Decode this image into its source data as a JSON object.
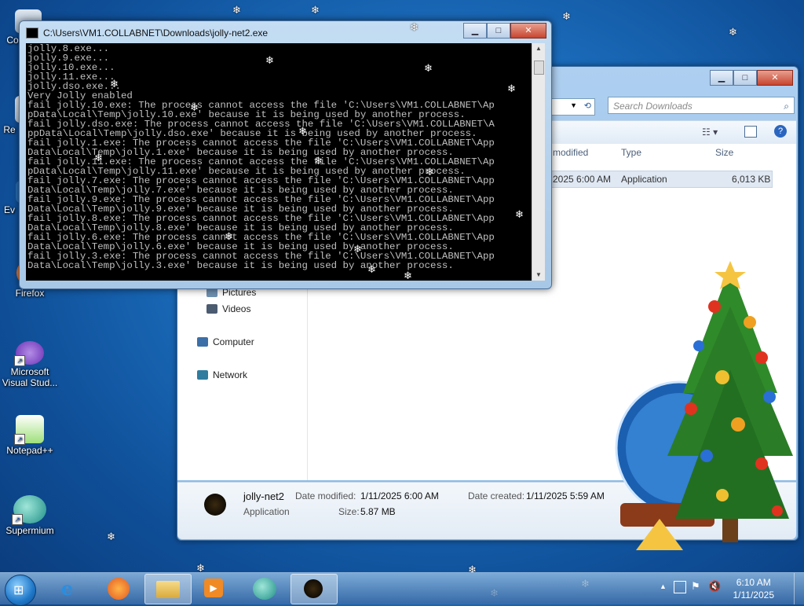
{
  "desktop": {
    "icons": [
      {
        "label": "Co"
      },
      {
        "label": "Re"
      },
      {
        "label": "Ev"
      },
      {
        "label": "Firefox"
      },
      {
        "label": "Microsoft Visual Stud..."
      },
      {
        "label": "Notepad++"
      },
      {
        "label": "Supermium"
      }
    ]
  },
  "console": {
    "title": "C:\\Users\\VM1.COLLABNET\\Downloads\\jolly-net2.exe",
    "lines": [
      "jolly.8.exe...",
      "jolly.9.exe...",
      "jolly.10.exe...",
      "jolly.11.exe...",
      "jolly.dso.exe...",
      "Very Jolly enabled",
      "fail jolly.10.exe: The process cannot access the file 'C:\\Users\\VM1.COLLABNET\\Ap",
      "pData\\Local\\Temp\\jolly.10.exe' because it is being used by another process.",
      "fail jolly.dso.exe: The process cannot access the file 'C:\\Users\\VM1.COLLABNET\\A",
      "ppData\\Local\\Temp\\jolly.dso.exe' because it is being used by another process.",
      "fail jolly.1.exe: The process cannot access the file 'C:\\Users\\VM1.COLLABNET\\App",
      "Data\\Local\\Temp\\jolly.1.exe' because it is being used by another process.",
      "fail jolly.11.exe: The process cannot access the file 'C:\\Users\\VM1.COLLABNET\\Ap",
      "pData\\Local\\Temp\\jolly.11.exe' because it is being used by another process.",
      "fail jolly.7.exe: The process cannot access the file 'C:\\Users\\VM1.COLLABNET\\App",
      "Data\\Local\\Temp\\jolly.7.exe' because it is being used by another process.",
      "fail jolly.9.exe: The process cannot access the file 'C:\\Users\\VM1.COLLABNET\\App",
      "Data\\Local\\Temp\\jolly.9.exe' because it is being used by another process.",
      "fail jolly.8.exe: The process cannot access the file 'C:\\Users\\VM1.COLLABNET\\App",
      "Data\\Local\\Temp\\jolly.8.exe' because it is being used by another process.",
      "fail jolly.6.exe: The process cannot access the file 'C:\\Users\\VM1.COLLABNET\\App",
      "Data\\Local\\Temp\\jolly.6.exe' because it is being used by another process.",
      "fail jolly.3.exe: The process cannot access the file 'C:\\Users\\VM1.COLLABNET\\App",
      "Data\\Local\\Temp\\jolly.3.exe' because it is being used by another process."
    ]
  },
  "explorer": {
    "search_placeholder": "Search Downloads",
    "columns": [
      "modified",
      "Type",
      "Size"
    ],
    "file_row": {
      "modified": "2025 6:00 AM",
      "type": "Application",
      "size": "6,013 KB"
    },
    "nav": [
      "Pictures",
      "Videos",
      "Computer",
      "Network"
    ],
    "details": {
      "name": "jolly-net2",
      "kind": "Application",
      "modified_label": "Date modified:",
      "modified_value": "1/11/2025 6:00 AM",
      "created_label": "Date created:",
      "created_value": "1/11/2025 5:59 AM",
      "size_label": "Size:",
      "size_value": "5.87 MB"
    }
  },
  "taskbar": {
    "time": "6:10 AM",
    "date": "1/11/2025"
  }
}
